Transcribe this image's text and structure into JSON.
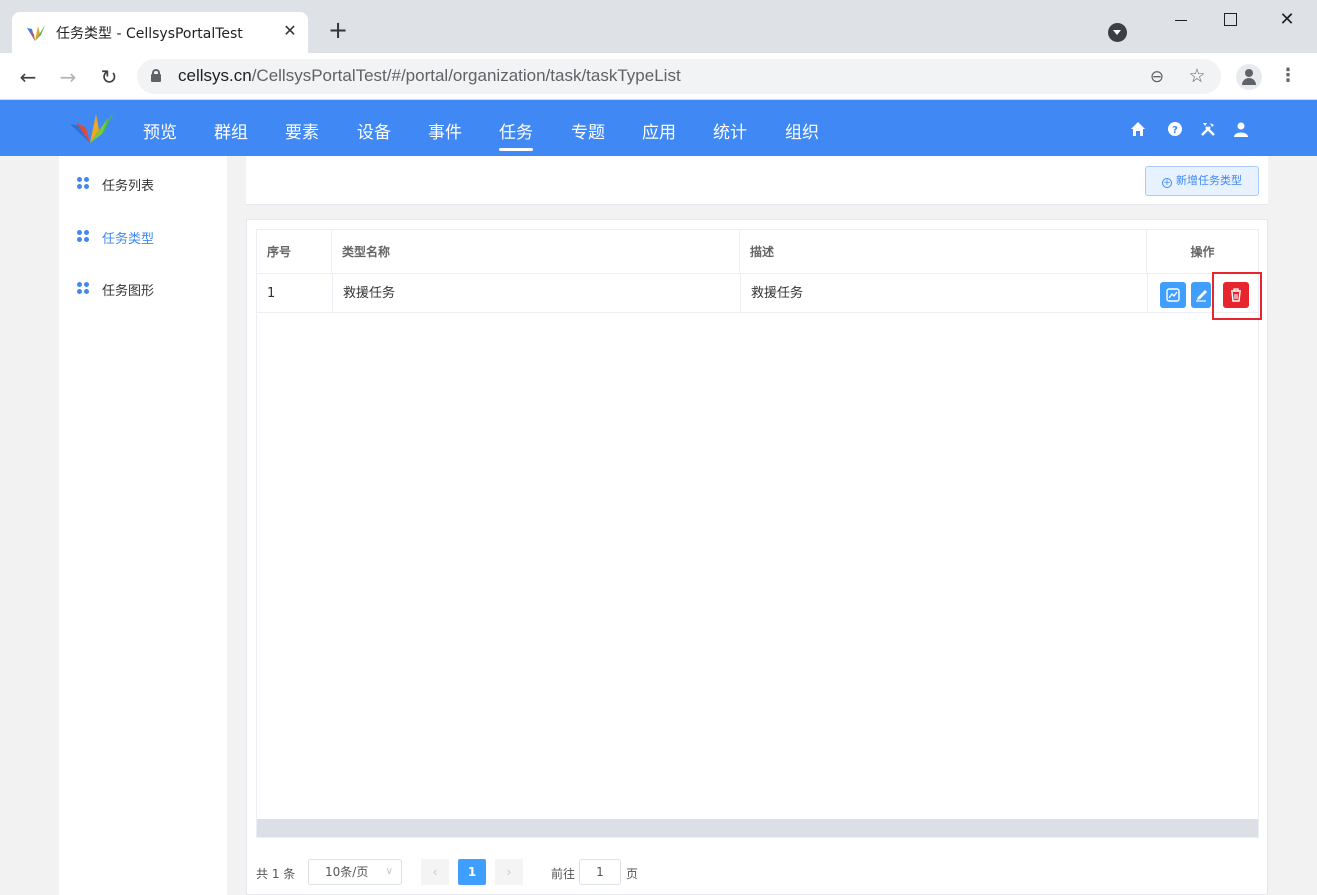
{
  "browser": {
    "tab_title": "任务类型 - CellsysPortalTest",
    "url_host": "cellsys.cn",
    "url_path": "/CellsysPortalTest/#/portal/organization/task/taskTypeList"
  },
  "header": {
    "nav": [
      {
        "label": "预览"
      },
      {
        "label": "群组"
      },
      {
        "label": "要素"
      },
      {
        "label": "设备"
      },
      {
        "label": "事件"
      },
      {
        "label": "任务",
        "active": true
      },
      {
        "label": "专题"
      },
      {
        "label": "应用"
      },
      {
        "label": "统计"
      },
      {
        "label": "组织"
      }
    ],
    "icons": [
      "home-icon",
      "help-icon",
      "tools-icon",
      "user-icon"
    ]
  },
  "sidebar": {
    "items": [
      {
        "label": "任务列表"
      },
      {
        "label": "任务类型",
        "active": true
      },
      {
        "label": "任务图形"
      }
    ]
  },
  "toolbar": {
    "add_label": "新增任务类型"
  },
  "table": {
    "columns": [
      "序号",
      "类型名称",
      "描述",
      "操作"
    ],
    "rows": [
      {
        "index": "1",
        "name": "救援任务",
        "description": "救援任务"
      }
    ]
  },
  "pagination": {
    "total": "共 1 条",
    "page_size": "10条/页",
    "current_page": "1",
    "goto_label": "前往",
    "goto_value": "1",
    "page_unit": "页"
  },
  "colors": {
    "header_bg": "#4088f4",
    "primary": "#409eff",
    "danger": "#e6252e"
  }
}
